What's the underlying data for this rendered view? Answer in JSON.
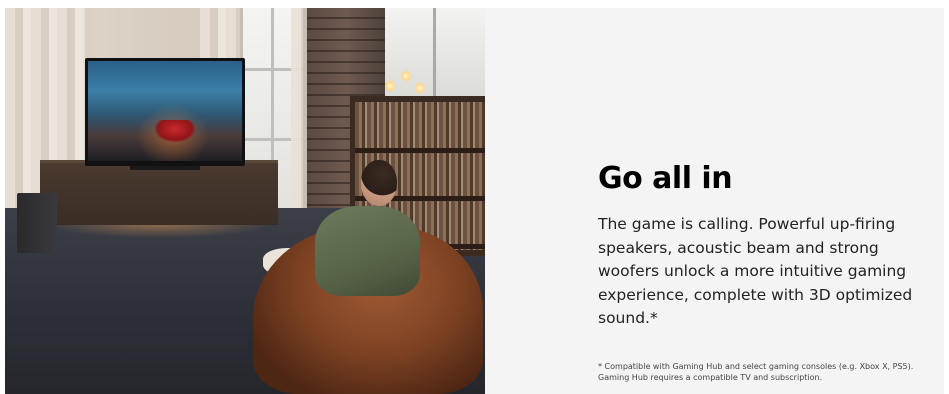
{
  "feature": {
    "image_alt": "Man in a bean bag chair playing a racing game on a TV with a soundbar and subwoofer",
    "heading": "Go all in",
    "body": "The game is calling. Powerful up-firing speakers, acoustic beam and strong woofers unlock a more intuitive gaming experience, complete with 3D optimized sound.*",
    "footnote_line1": "* Compatible with Gaming Hub and select gaming consoles (e.g. Xbox X, PS5).",
    "footnote_line2": "Gaming Hub requires a compatible TV and subscription."
  },
  "colors": {
    "panel_background": "#f4f4f4",
    "heading": "#000000",
    "body_text": "#222222"
  }
}
